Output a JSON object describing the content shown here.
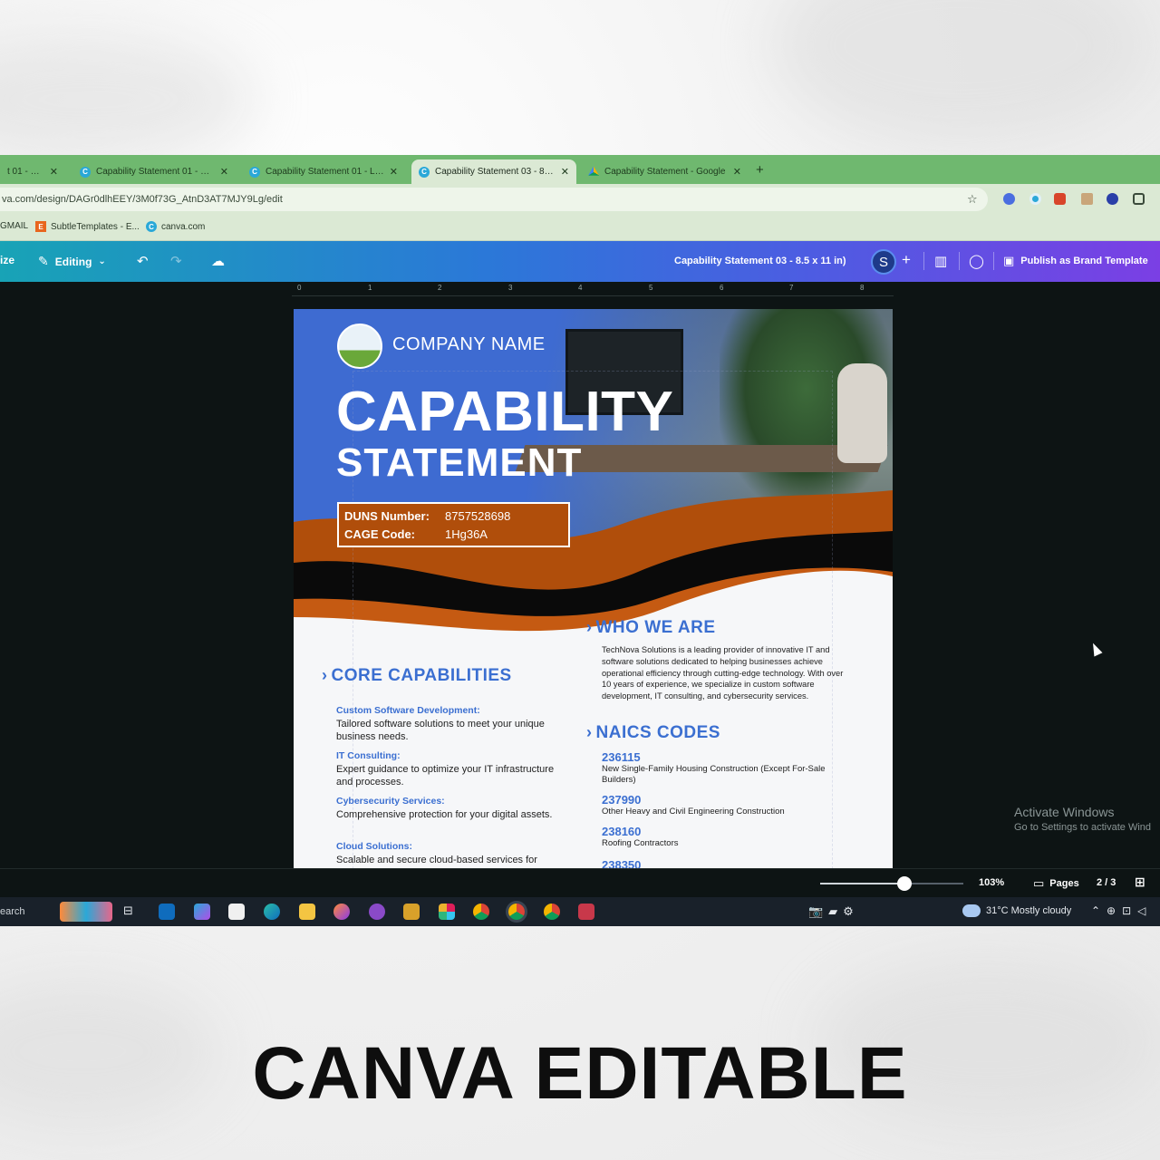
{
  "browser": {
    "tabs": [
      {
        "title": "t 01 - Canva"
      },
      {
        "title": "Capability Statement 01 - File i"
      },
      {
        "title": "Capability Statement 01 - Listin"
      },
      {
        "title": "Capability Statement 03 - 8.5 x",
        "active": true
      },
      {
        "title": "Capability Statement - Google"
      }
    ],
    "new_tab": "+",
    "url": "va.com/design/DAGr0dlhEEY/3M0f73G_AtnD3AT7MJY9Lg/edit",
    "bookmarks": [
      "GMAIL",
      "SubtleTemplates - E...",
      "canva.com"
    ]
  },
  "canva": {
    "resize": "ize",
    "editing": "Editing",
    "doc_title": "Capability Statement 03 - 8.5 x 11 in)",
    "avatar": "S",
    "publish": "Publish as Brand Template",
    "ruler": [
      "0",
      "1",
      "2",
      "3",
      "4",
      "5",
      "6",
      "7",
      "8"
    ],
    "zoom": "103%",
    "pages_label": "Pages",
    "page_count": "2 / 3"
  },
  "document": {
    "company": "COMPANY NAME",
    "title_line1": "CAPABILITY",
    "title_line2": "STATEMENT",
    "duns_label": "DUNS Number:",
    "duns_value": "8757528698",
    "cage_label": "CAGE Code:",
    "cage_value": "1Hg36A",
    "core_title": "CORE CAPABILITIES",
    "capabilities": [
      {
        "heading": "Custom Software Development:",
        "text": "Tailored software solutions to meet your unique business needs."
      },
      {
        "heading": "IT Consulting:",
        "text": "Expert guidance to optimize your IT infrastructure and processes."
      },
      {
        "heading": "Cybersecurity Services:",
        "text": "Comprehensive protection for your digital assets."
      },
      {
        "heading": "Cloud Solutions:",
        "text": "Scalable and secure cloud-based services for"
      }
    ],
    "who_title": "WHO WE ARE",
    "who_text": "TechNova Solutions is a leading provider of innovative IT and software solutions dedicated to helping businesses achieve operational efficiency through cutting-edge technology. With over 10 years of experience, we specialize in custom software development, IT consulting, and cybersecurity services.",
    "naics_title": "NAICS CODES",
    "naics": [
      {
        "code": "236115",
        "desc": "New Single-Family Housing Construction (Except For-Sale Builders)"
      },
      {
        "code": "237990",
        "desc": "Other Heavy and Civil Engineering Construction"
      },
      {
        "code": "238160",
        "desc": "Roofing Contractors"
      },
      {
        "code": "238350",
        "desc": ""
      }
    ]
  },
  "windows": {
    "activate_title": "Activate Windows",
    "activate_sub": "Go to Settings to activate Wind",
    "search": "earch",
    "weather": "31°C  Mostly cloudy"
  },
  "caption": "CANVA EDITABLE",
  "colors": {
    "tab_green": "#6fb86f",
    "canva_gradient_start": "#18a3b6",
    "canva_gradient_end": "#7b3fe4",
    "doc_blue": "#3b6fd1",
    "doc_orange": "#b04e0b"
  }
}
